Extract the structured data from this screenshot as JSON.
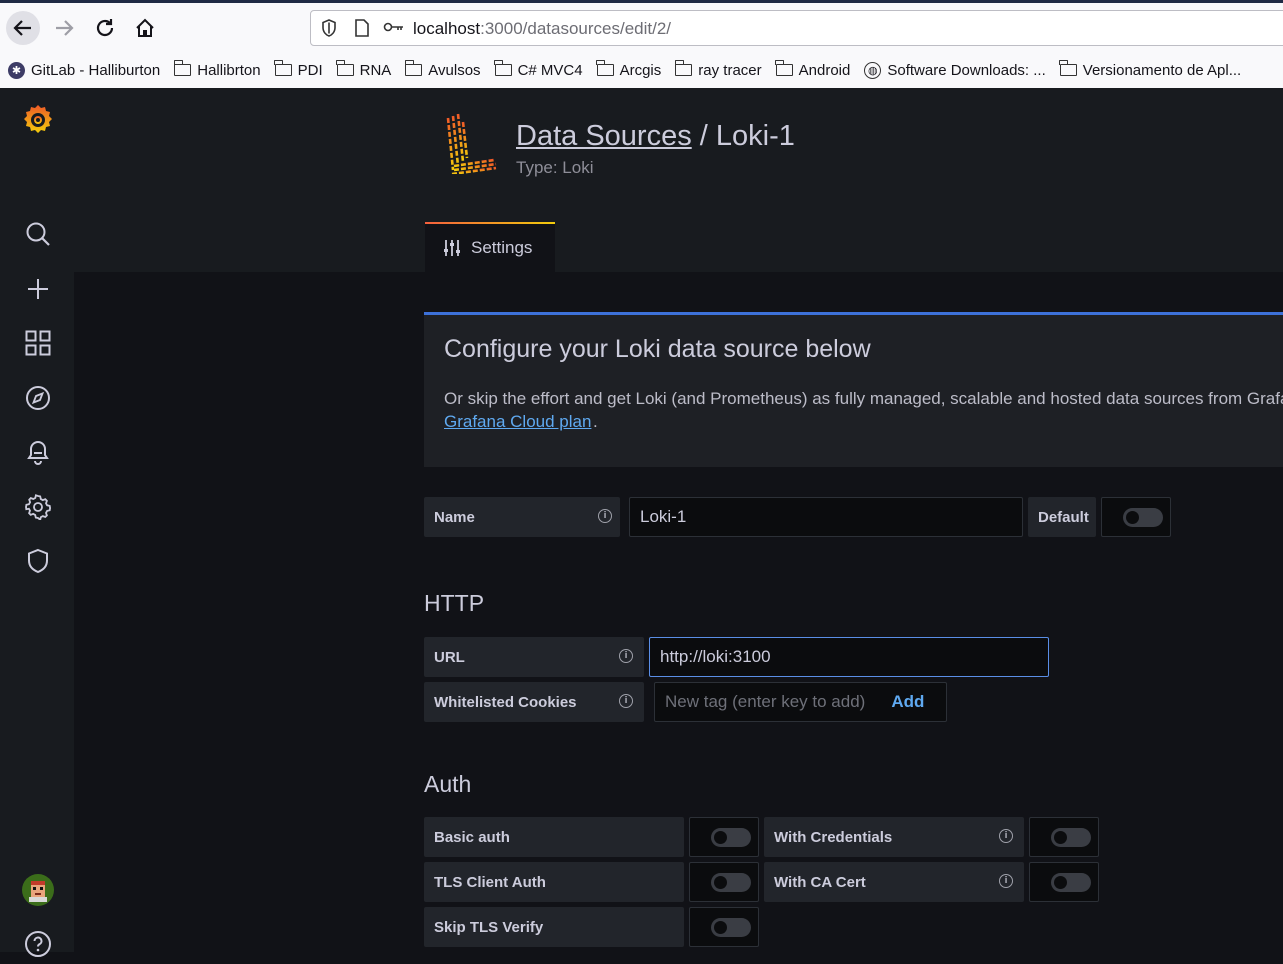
{
  "browser": {
    "url_host": "localhost",
    "url_path": ":3000/datasources/edit/2/",
    "bookmarks": [
      {
        "label": "GitLab - Halliburton",
        "icon": "gitlab-icon"
      },
      {
        "label": "Hallibrton",
        "icon": "folder-icon"
      },
      {
        "label": "PDI",
        "icon": "folder-icon"
      },
      {
        "label": "RNA",
        "icon": "folder-icon"
      },
      {
        "label": "Avulsos",
        "icon": "folder-icon"
      },
      {
        "label": "C# MVC4",
        "icon": "folder-icon"
      },
      {
        "label": "Arcgis",
        "icon": "folder-icon"
      },
      {
        "label": "ray tracer",
        "icon": "folder-icon"
      },
      {
        "label": "Android",
        "icon": "folder-icon"
      },
      {
        "label": "Software Downloads: ...",
        "icon": "globe-icon"
      },
      {
        "label": "Versionamento de Apl...",
        "icon": "folder-icon"
      }
    ]
  },
  "header": {
    "breadcrumb": "Data Sources",
    "separator": " / ",
    "title": "Loki-1",
    "type": "Type: Loki"
  },
  "tabs": [
    {
      "label": "Settings"
    }
  ],
  "info": {
    "title": "Configure your Loki data source below",
    "text": "Or skip the effort and get Loki (and Prometheus) as fully managed, scalable and hosted data sources from Grafana Labs with the free-forever",
    "link": "Grafana Cloud plan",
    "link_suffix": "."
  },
  "form": {
    "name_label": "Name",
    "name_value": "Loki-1",
    "default_label": "Default",
    "default_on": false
  },
  "http": {
    "section": "HTTP",
    "url_label": "URL",
    "url_value": "http://loki:3100",
    "cookies_label": "Whitelisted Cookies",
    "cookies_placeholder": "New tag (enter key to add)",
    "add_label": "Add"
  },
  "auth": {
    "section": "Auth",
    "basic_auth": "Basic auth",
    "with_credentials": "With Credentials",
    "tls_client_auth": "TLS Client Auth",
    "with_ca_cert": "With CA Cert",
    "skip_tls_verify": "Skip TLS Verify"
  },
  "colors": {
    "accent": "#3d71d9",
    "link": "#5fa9f0",
    "tab_gradient_start": "#f55f3e",
    "tab_gradient_end": "#f2cc0c"
  }
}
